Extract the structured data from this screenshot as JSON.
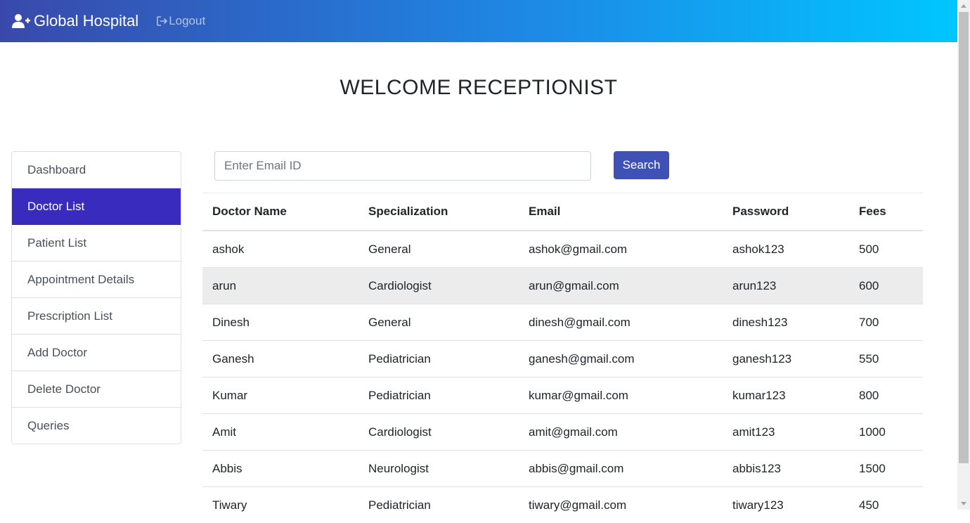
{
  "navbar": {
    "brand_icon": "user-plus-icon",
    "brand": "Global Hospital",
    "logout_icon": "sign-out-icon",
    "logout": "Logout",
    "gradient_colors": [
      "#3949ab",
      "#1e88e5",
      "#00c6ff"
    ]
  },
  "welcome": "WELCOME RECEPTIONIST",
  "sidebar": {
    "active_color": "#3a2bbf",
    "items": [
      {
        "label": "Dashboard"
      },
      {
        "label": "Doctor List",
        "active": true
      },
      {
        "label": "Patient List"
      },
      {
        "label": "Appointment Details"
      },
      {
        "label": "Prescription List"
      },
      {
        "label": "Add Doctor"
      },
      {
        "label": "Delete Doctor"
      },
      {
        "label": "Queries"
      }
    ]
  },
  "search": {
    "placeholder": "Enter Email ID",
    "value": "",
    "button": "Search",
    "button_color": "#3f51b5"
  },
  "table": {
    "headers": [
      "Doctor Name",
      "Specialization",
      "Email",
      "Password",
      "Fees"
    ],
    "rows": [
      [
        "ashok",
        "General",
        "ashok@gmail.com",
        "ashok123",
        "500"
      ],
      [
        "arun",
        "Cardiologist",
        "arun@gmail.com",
        "arun123",
        "600"
      ],
      [
        "Dinesh",
        "General",
        "dinesh@gmail.com",
        "dinesh123",
        "700"
      ],
      [
        "Ganesh",
        "Pediatrician",
        "ganesh@gmail.com",
        "ganesh123",
        "550"
      ],
      [
        "Kumar",
        "Pediatrician",
        "kumar@gmail.com",
        "kumar123",
        "800"
      ],
      [
        "Amit",
        "Cardiologist",
        "amit@gmail.com",
        "amit123",
        "1000"
      ],
      [
        "Abbis",
        "Neurologist",
        "abbis@gmail.com",
        "abbis123",
        "1500"
      ],
      [
        "Tiwary",
        "Pediatrician",
        "tiwary@gmail.com",
        "tiwary123",
        "450"
      ]
    ]
  }
}
